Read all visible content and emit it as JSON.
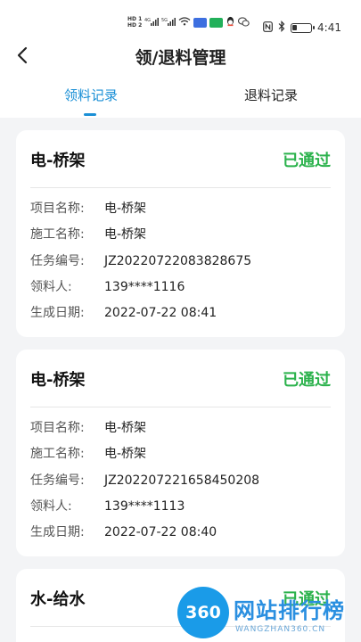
{
  "status_bar": {
    "time": "4:41",
    "hd1": "HD 1",
    "hd2": "HD 2",
    "net1": "4G",
    "net2": "5G"
  },
  "nav": {
    "title": "领/退料管理"
  },
  "tabs": [
    {
      "label": "领料记录",
      "active": true
    },
    {
      "label": "退料记录",
      "active": false
    }
  ],
  "labels": {
    "project": "项目名称:",
    "construction": "施工名称:",
    "task_no": "任务编号:",
    "receiver": "领料人:",
    "created": "生成日期:"
  },
  "records": [
    {
      "title": "电-桥架",
      "status": "已通过",
      "project": "电-桥架",
      "construction": "电-桥架",
      "task_no": "JZ20220722083828675",
      "receiver": "139****1116",
      "created": "2022-07-22 08:41"
    },
    {
      "title": "电-桥架",
      "status": "已通过",
      "project": "电-桥架",
      "construction": "电-桥架",
      "task_no": "JZ20220722165845020​8",
      "receiver": "139****1113",
      "created": "2022-07-22 08:40"
    },
    {
      "title": "水-给水",
      "status": "已通过"
    }
  ],
  "watermark": {
    "logo": "360",
    "text": "网站排行榜",
    "sub": "WANGZHAN360.CN"
  },
  "colors": {
    "accent": "#1a8fd6",
    "status_ok": "#2bb24c"
  }
}
